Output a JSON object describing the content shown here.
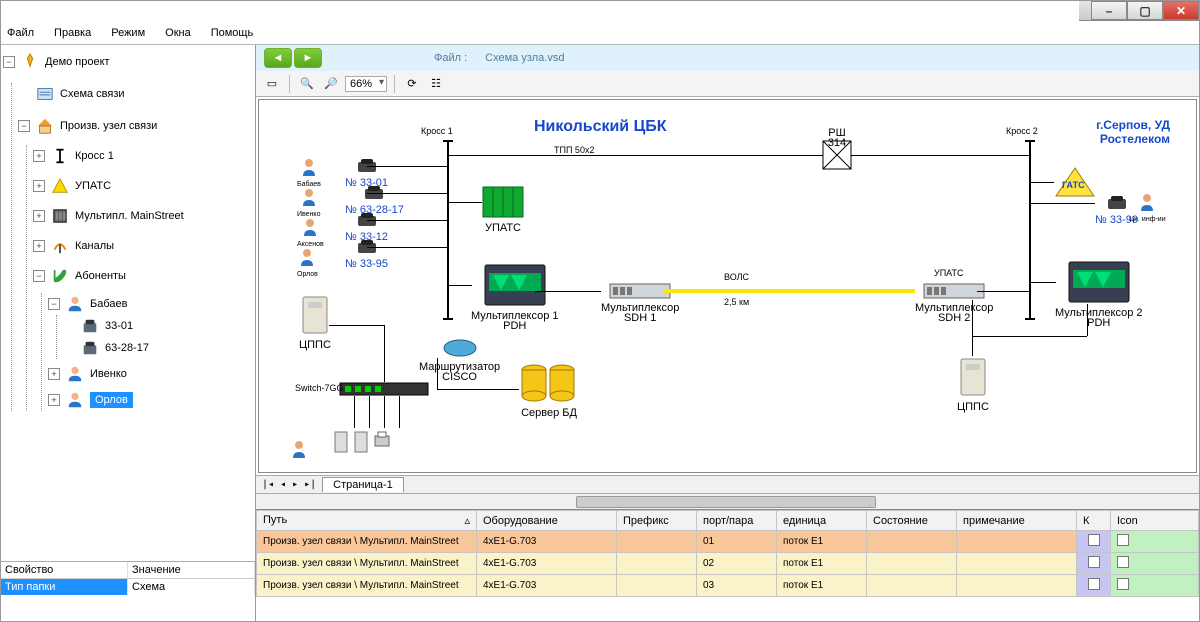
{
  "menu": {
    "items": [
      "Файл",
      "Правка",
      "Режим",
      "Окна",
      "Помощь"
    ]
  },
  "winbuttons": {
    "min": "–",
    "max": "▢",
    "close": "✕"
  },
  "tree": {
    "root": "Демо проект",
    "n1": "Схема связи",
    "n2": "Произв. узел связи",
    "n3": "Кросс 1",
    "n4": "УПАТС",
    "n5": "Мультипл. MainStreet",
    "n6": "Каналы",
    "n7": "Абоненты",
    "n8": "Бабаев",
    "n9": "33-01",
    "n10": "63-28-17",
    "n11": "Ивенко",
    "n12": "Орлов"
  },
  "props": {
    "header_key": "Свойство",
    "header_val": "Значение",
    "row_key": "Тип папки",
    "row_val": "Схема"
  },
  "file": {
    "label": "Файл :",
    "name": "Схема узла.vsd"
  },
  "toolbar": {
    "zoom": "66%"
  },
  "diagram": {
    "title": "Никольский ЦБК",
    "right_title": "г.Серпов, УД\nРостелеком",
    "cross1": "Кросс 1",
    "cross2": "Кросс 2",
    "tpp": "ТПП 50х2",
    "rsh": "РШ 314",
    "gats": "ГАТС",
    "upats_l": "УПАТС",
    "upats_r": "УПАТС",
    "mux1": "Мультиплексор 1\nPDH",
    "mux_sdh1": "Мультиплексор\nSDH 1",
    "mux_sdh2": "Мультиплексор\nSDH 2",
    "mux2": "Мультиплексор 2\nPDH",
    "vols": "ВОЛС",
    "vols_len": "2,5 км",
    "cpps_l": "ЦППС",
    "cpps_r": "ЦППС",
    "router": "Маршрутизатор\nCISCO",
    "switch": "Switch-7GG",
    "srv": "Сервер БД",
    "phones": {
      "a": "№ 33-01",
      "b": "№ 63-28-17",
      "c": "№ 33-12",
      "d": "№ 33-95",
      "e": "№ 33-99"
    },
    "people": {
      "a": "Бабаев",
      "b": "Ивенко",
      "c": "Аксенов",
      "d": "Орлов"
    },
    "page": "Страница-1",
    "info": "Цн. инф-ии"
  },
  "grid": {
    "headers": [
      "Путь",
      "Оборудование",
      "Префикс",
      "порт/пара",
      "единица",
      "Состояние",
      "примечание",
      "К",
      "Icon"
    ],
    "rows": [
      {
        "path": "Произв. узел связи \\ Мультипл. MainStreet",
        "eq": "4xE1-G.703",
        "prefix": "",
        "port": "01",
        "unit": "поток E1",
        "state": "",
        "note": ""
      },
      {
        "path": "Произв. узел связи \\ Мультипл. MainStreet",
        "eq": "4xE1-G.703",
        "prefix": "",
        "port": "02",
        "unit": "поток E1",
        "state": "",
        "note": ""
      },
      {
        "path": "Произв. узел связи \\ Мультипл. MainStreet",
        "eq": "4xE1-G.703",
        "prefix": "",
        "port": "03",
        "unit": "поток E1",
        "state": "",
        "note": ""
      }
    ]
  }
}
